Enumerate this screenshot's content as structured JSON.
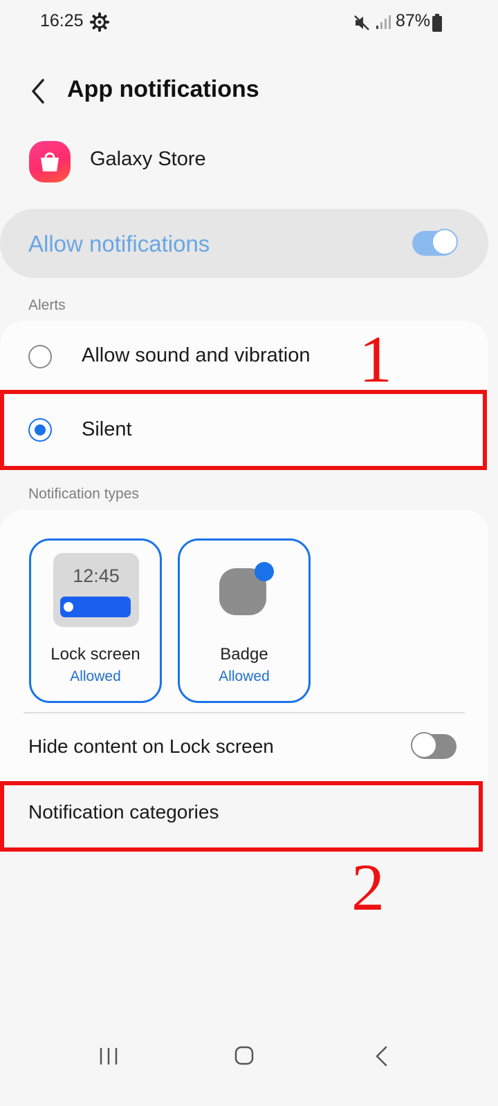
{
  "status_bar": {
    "time": "16:25",
    "battery_percent": "87%",
    "icons": [
      "gear-icon",
      "mute-icon",
      "signal-icon",
      "battery-icon"
    ]
  },
  "header": {
    "title": "App notifications",
    "back_icon": "chevron-left-icon"
  },
  "app": {
    "name": "Galaxy Store",
    "icon": "shopping-bag-icon"
  },
  "allow_notifications": {
    "label": "Allow notifications",
    "enabled": true
  },
  "alerts": {
    "section_label": "Alerts",
    "options": [
      {
        "label": "Allow sound and vibration",
        "selected": false
      },
      {
        "label": "Silent",
        "selected": true
      }
    ]
  },
  "notification_types": {
    "section_label": "Notification types",
    "tiles": [
      {
        "title": "Lock screen",
        "status": "Allowed",
        "preview_time": "12:45"
      },
      {
        "title": "Badge",
        "status": "Allowed"
      }
    ]
  },
  "hide_content": {
    "label": "Hide content on Lock screen",
    "enabled": false
  },
  "notification_categories": {
    "label": "Notification categories"
  },
  "annotations": [
    "1",
    "2"
  ],
  "colors": {
    "accent": "#1a73e8",
    "annotation": "#ee1111",
    "toggle_on": "#8bbaf0"
  },
  "nav_bar": {
    "icons": [
      "recent-apps-icon",
      "home-icon",
      "back-icon"
    ]
  }
}
